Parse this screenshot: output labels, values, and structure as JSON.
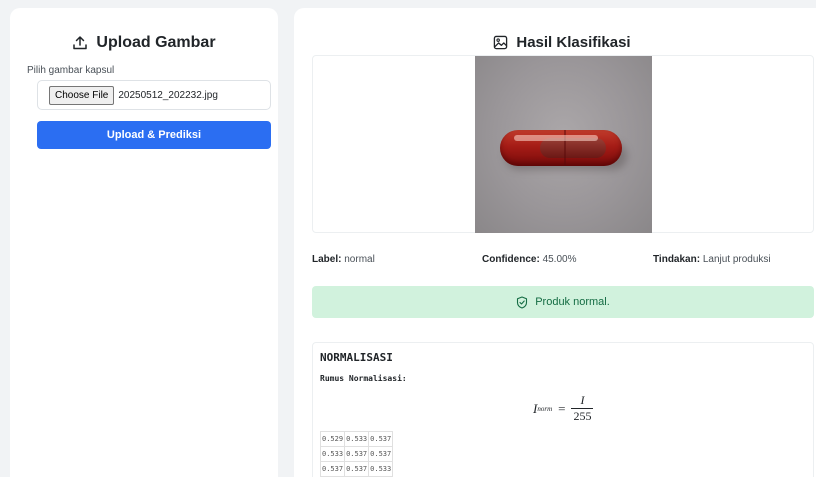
{
  "upload": {
    "title": "Upload Gambar",
    "field_label": "Pilih gambar kapsul",
    "choose_button": "Choose File",
    "file_name": "20250512_202232.jpg",
    "submit_label": "Upload & Prediksi"
  },
  "result": {
    "title": "Hasil Klasifikasi",
    "image_alt": "capsule photo",
    "label_key": "Label:",
    "label_value": "normal",
    "confidence_key": "Confidence:",
    "confidence_value": "45.00%",
    "action_key": "Tindakan:",
    "action_value": "Lanjut produksi",
    "alert": "Produk normal."
  },
  "normalization": {
    "title": "NORMALISASI",
    "formula_label": "Rumus Normalisasi:",
    "formula": {
      "lhs": "I",
      "lhs_sub": "norm",
      "eq": "=",
      "numerator": "I",
      "denominator": "255"
    },
    "matrix": [
      [
        "0.529",
        "0.533",
        "0.537"
      ],
      [
        "0.533",
        "0.537",
        "0.537"
      ],
      [
        "0.537",
        "0.537",
        "0.533"
      ]
    ]
  },
  "colors": {
    "primary": "#2b6ef2",
    "success_bg": "#d1f2dd",
    "success_text": "#146c43",
    "capsule": "#a51c16"
  },
  "icons": {
    "upload": "upload-icon",
    "image": "image-icon",
    "check": "shield-check-icon"
  }
}
